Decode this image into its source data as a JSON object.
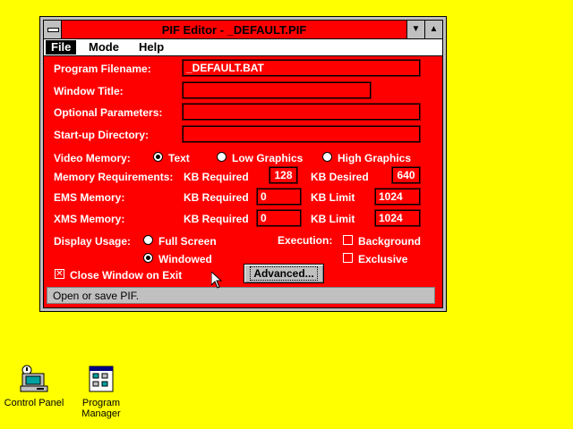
{
  "window": {
    "title": "PIF Editor - _DEFAULT.PIF",
    "min_glyph": "▼",
    "max_glyph": "▲"
  },
  "menu": {
    "file": "File",
    "mode": "Mode",
    "help": "Help"
  },
  "form": {
    "program_filename_label": "Program Filename:",
    "program_filename_value": "_DEFAULT.BAT",
    "window_title_label": "Window Title:",
    "window_title_value": "",
    "optional_params_label": "Optional Parameters:",
    "optional_params_value": "",
    "startup_dir_label": "Start-up Directory:",
    "startup_dir_value": "",
    "video_memory_label": "Video Memory:",
    "video_options": [
      "Text",
      "Low Graphics",
      "High Graphics"
    ],
    "video_selected": "Text",
    "mem_req_label": "Memory Requirements:",
    "kb_required_label": "KB Required",
    "kb_required_value": "128",
    "kb_desired_label": "KB Desired",
    "kb_desired_value": "640",
    "ems_label": "EMS Memory:",
    "ems_required_label": "KB Required",
    "ems_required_value": "0",
    "ems_limit_label": "KB Limit",
    "ems_limit_value": "1024",
    "xms_label": "XMS Memory:",
    "xms_required_label": "KB Required",
    "xms_required_value": "0",
    "xms_limit_label": "KB Limit",
    "xms_limit_value": "1024",
    "display_usage_label": "Display Usage:",
    "full_screen_label": "Full Screen",
    "windowed_label": "Windowed",
    "display_selected": "Windowed",
    "execution_label": "Execution:",
    "background_label": "Background",
    "exclusive_label": "Exclusive",
    "close_on_exit_label": "Close Window on Exit",
    "close_on_exit_checked": true,
    "advanced_button": "Advanced..."
  },
  "status": {
    "text": "Open or save PIF."
  },
  "desktop": {
    "icons": [
      {
        "label": "Control Panel",
        "icon": "control-panel-icon"
      },
      {
        "label": "Program Manager",
        "icon": "program-manager-icon"
      }
    ]
  }
}
